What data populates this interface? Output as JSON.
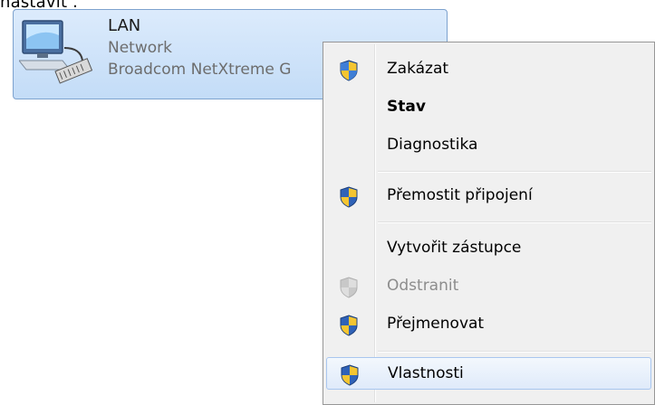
{
  "top_text": "nastavit .",
  "adapter": {
    "name": "LAN",
    "status": "Network",
    "device": "Broadcom NetXtreme G",
    "icon": "network-adapter-icon"
  },
  "menu": {
    "items": [
      {
        "label": "Zakázat",
        "icon": "uac-shield-icon",
        "bold": false,
        "disabled": false
      },
      {
        "label": "Stav",
        "icon": null,
        "bold": true,
        "disabled": false
      },
      {
        "label": "Diagnostika",
        "icon": null,
        "bold": false,
        "disabled": false
      },
      {
        "label": "Přemostit připojení",
        "icon": "uac-shield-icon",
        "bold": false,
        "disabled": false
      },
      {
        "label": "Vytvořit zástupce",
        "icon": null,
        "bold": false,
        "disabled": false
      },
      {
        "label": "Odstranit",
        "icon": "uac-shield-icon",
        "bold": false,
        "disabled": true
      },
      {
        "label": "Přejmenovat",
        "icon": "uac-shield-icon",
        "bold": false,
        "disabled": false
      },
      {
        "label": "Vlastnosti",
        "icon": "uac-shield-icon",
        "bold": false,
        "disabled": false,
        "highlighted": true
      }
    ]
  },
  "colors": {
    "selection_bg": "#c3dcf7",
    "selection_border": "#7da2ce",
    "menu_bg": "#f0f0f0",
    "disabled_text": "#8d8d8d"
  }
}
